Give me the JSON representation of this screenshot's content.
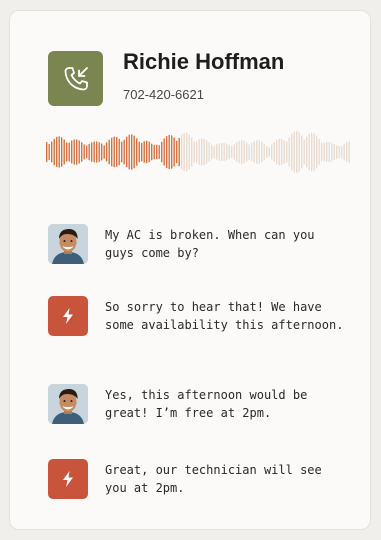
{
  "contact": {
    "name": "Richie Hoffman",
    "phone": "702-420-6621",
    "icon": "incoming-call-icon",
    "color": "#7b8551"
  },
  "recording": {
    "progress": 0.44,
    "played_color": "#d4733e",
    "unplayed_color": "#eadbd1"
  },
  "messages": [
    {
      "sender": "customer",
      "text": "My AC is broken. When can you guys come by?"
    },
    {
      "sender": "business",
      "text": "So sorry to hear that! We have some availability this afternoon."
    },
    {
      "sender": "customer",
      "text": "Yes, this afternoon would be great! I’m free at 2pm."
    },
    {
      "sender": "business",
      "text": "Great, our technician will see you at 2pm."
    }
  ],
  "business_icon": "lightning-bolt-icon",
  "business_color": "#c8553b"
}
